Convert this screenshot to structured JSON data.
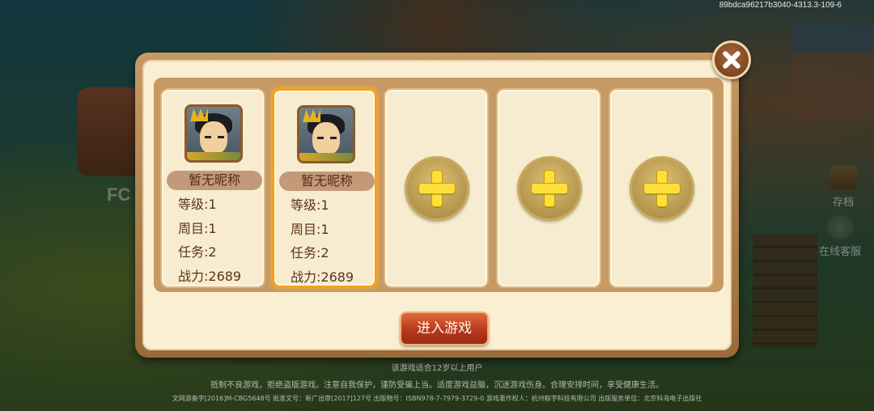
{
  "build_id": "89bdca96217b3040-4313.3-109-6",
  "background": {
    "logo_text": "FC",
    "side_buttons": {
      "save": "存档",
      "support": "在线客服"
    },
    "footer": {
      "age_notice": "该游戏适合12岁以上用户",
      "health_notice": "抵制不良游戏，拒绝盗版游戏。注意自我保护，谨防受骗上当。适度游戏益脑，沉迷游戏伤身。合理安排时间，享受健康生活。",
      "license": "文网游备字[2016]M-CBG5648号 批准文号：新广出审[2017]127号 出版物号：ISBN978-7-7979-3729-0 游戏著作权人：杭州鲸宇科技有限公司 出版服务单位：北京科海电子出版社"
    }
  },
  "dialog": {
    "slots": [
      {
        "type": "character",
        "nickname": "暂无昵称",
        "level": "等级:1",
        "round": "周目:1",
        "mission": "任务:2",
        "power": "战力:2689",
        "selected": false
      },
      {
        "type": "character",
        "nickname": "暂无昵称",
        "level": "等级:1",
        "round": "周目:1",
        "mission": "任务:2",
        "power": "战力:2689",
        "selected": true
      },
      {
        "type": "empty",
        "icon": "plus-icon"
      },
      {
        "type": "empty",
        "icon": "plus-icon"
      },
      {
        "type": "empty",
        "icon": "plus-icon"
      }
    ],
    "enter_button": "进入游戏",
    "close_icon": "close-icon"
  },
  "colors": {
    "panel_frame": "#c79a63",
    "panel_fill": "#fbefd3",
    "selected_border": "#f3a21a",
    "enter_button": "#b8381e",
    "plus": "#ffe03a"
  }
}
